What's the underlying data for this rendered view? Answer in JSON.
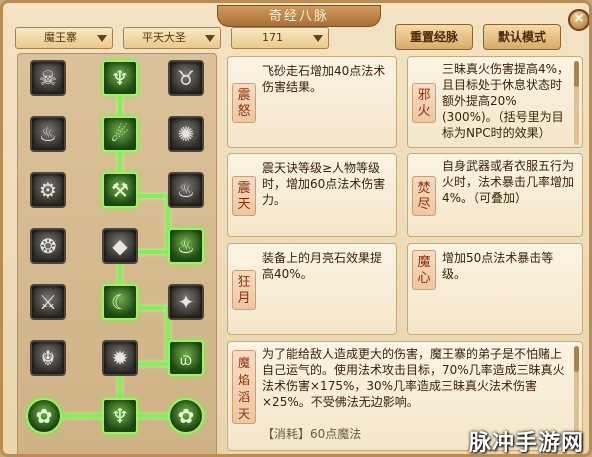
{
  "window": {
    "title": "奇经八脉",
    "close_label": "✕"
  },
  "toolbar": {
    "sect_select": "魔王寨",
    "school_select": "平天大圣",
    "level_select": "171",
    "reset_label": "重置经脉",
    "default_label": "默认模式"
  },
  "skills": [
    {
      "title": "震怒",
      "desc": "飞砂走石增加40点法术伤害结果。"
    },
    {
      "title": "邪火",
      "desc": "三昧真火伤害提高4%，且目标处于休息状态时额外提高20%(300%)。（括号里为目标为NPC时的效果）"
    },
    {
      "title": "震天",
      "desc": "震天诀等级≥人物等级时，增加60点法术伤害力。"
    },
    {
      "title": "焚尽",
      "desc": "自身武器或者衣服五行为火时，法术暴击几率增加4%。（可叠加）"
    },
    {
      "title": "狂月",
      "desc": "装备上的月亮石效果提高40%。"
    },
    {
      "title": "魔心",
      "desc": "增加50点法术暴击等级。"
    },
    {
      "title": "魔焰滔天",
      "desc": "为了能给敌人造成更大的伤害，魔王寨的弟子是不怕赌上自己运气的。使用法术攻击目标，70%几率造成三昧真火法术伤害×175%，30%几率造成三昧真火法术伤害×25%。不受佛法无边影响。",
      "cost": "【消耗】60点魔法"
    }
  ],
  "watermark": "脉冲手游网"
}
